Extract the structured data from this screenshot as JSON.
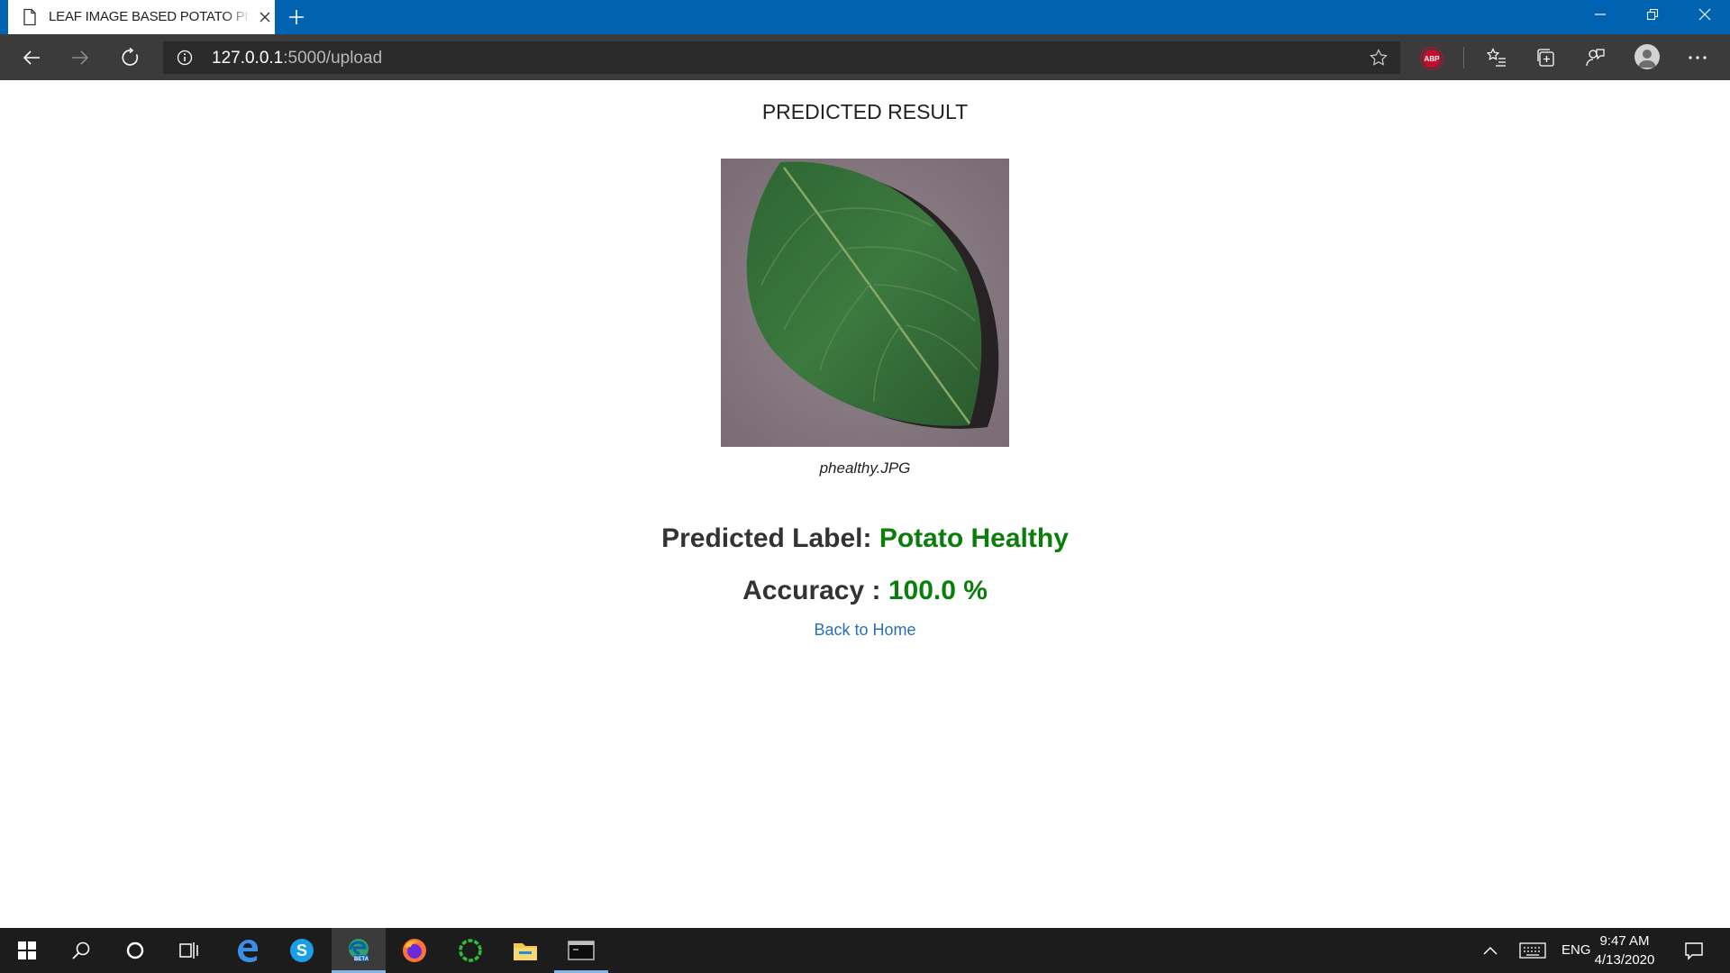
{
  "browser": {
    "tab_title": "LEAF IMAGE BASED POTATO PLA",
    "url_host": "127.0.0.1",
    "url_path": ":5000/upload",
    "extension_abp_label": "ABP"
  },
  "page": {
    "heading": "PREDICTED RESULT",
    "image_caption": "phealthy.JPG",
    "label_prefix": "Predicted Label: ",
    "label_value": "Potato Healthy",
    "accuracy_prefix": "Accuracy : ",
    "accuracy_value": "100.0 %",
    "home_link": "Back to Home"
  },
  "taskbar": {
    "language": "ENG",
    "time": "9:47 AM",
    "date": "4/13/2020"
  },
  "colors": {
    "titlebar": "#0063b1",
    "toolbar": "#3b3b3b",
    "result_green": "#0a7e0a",
    "link_blue": "#2a6fb6",
    "taskbar": "#1c1c1c"
  }
}
